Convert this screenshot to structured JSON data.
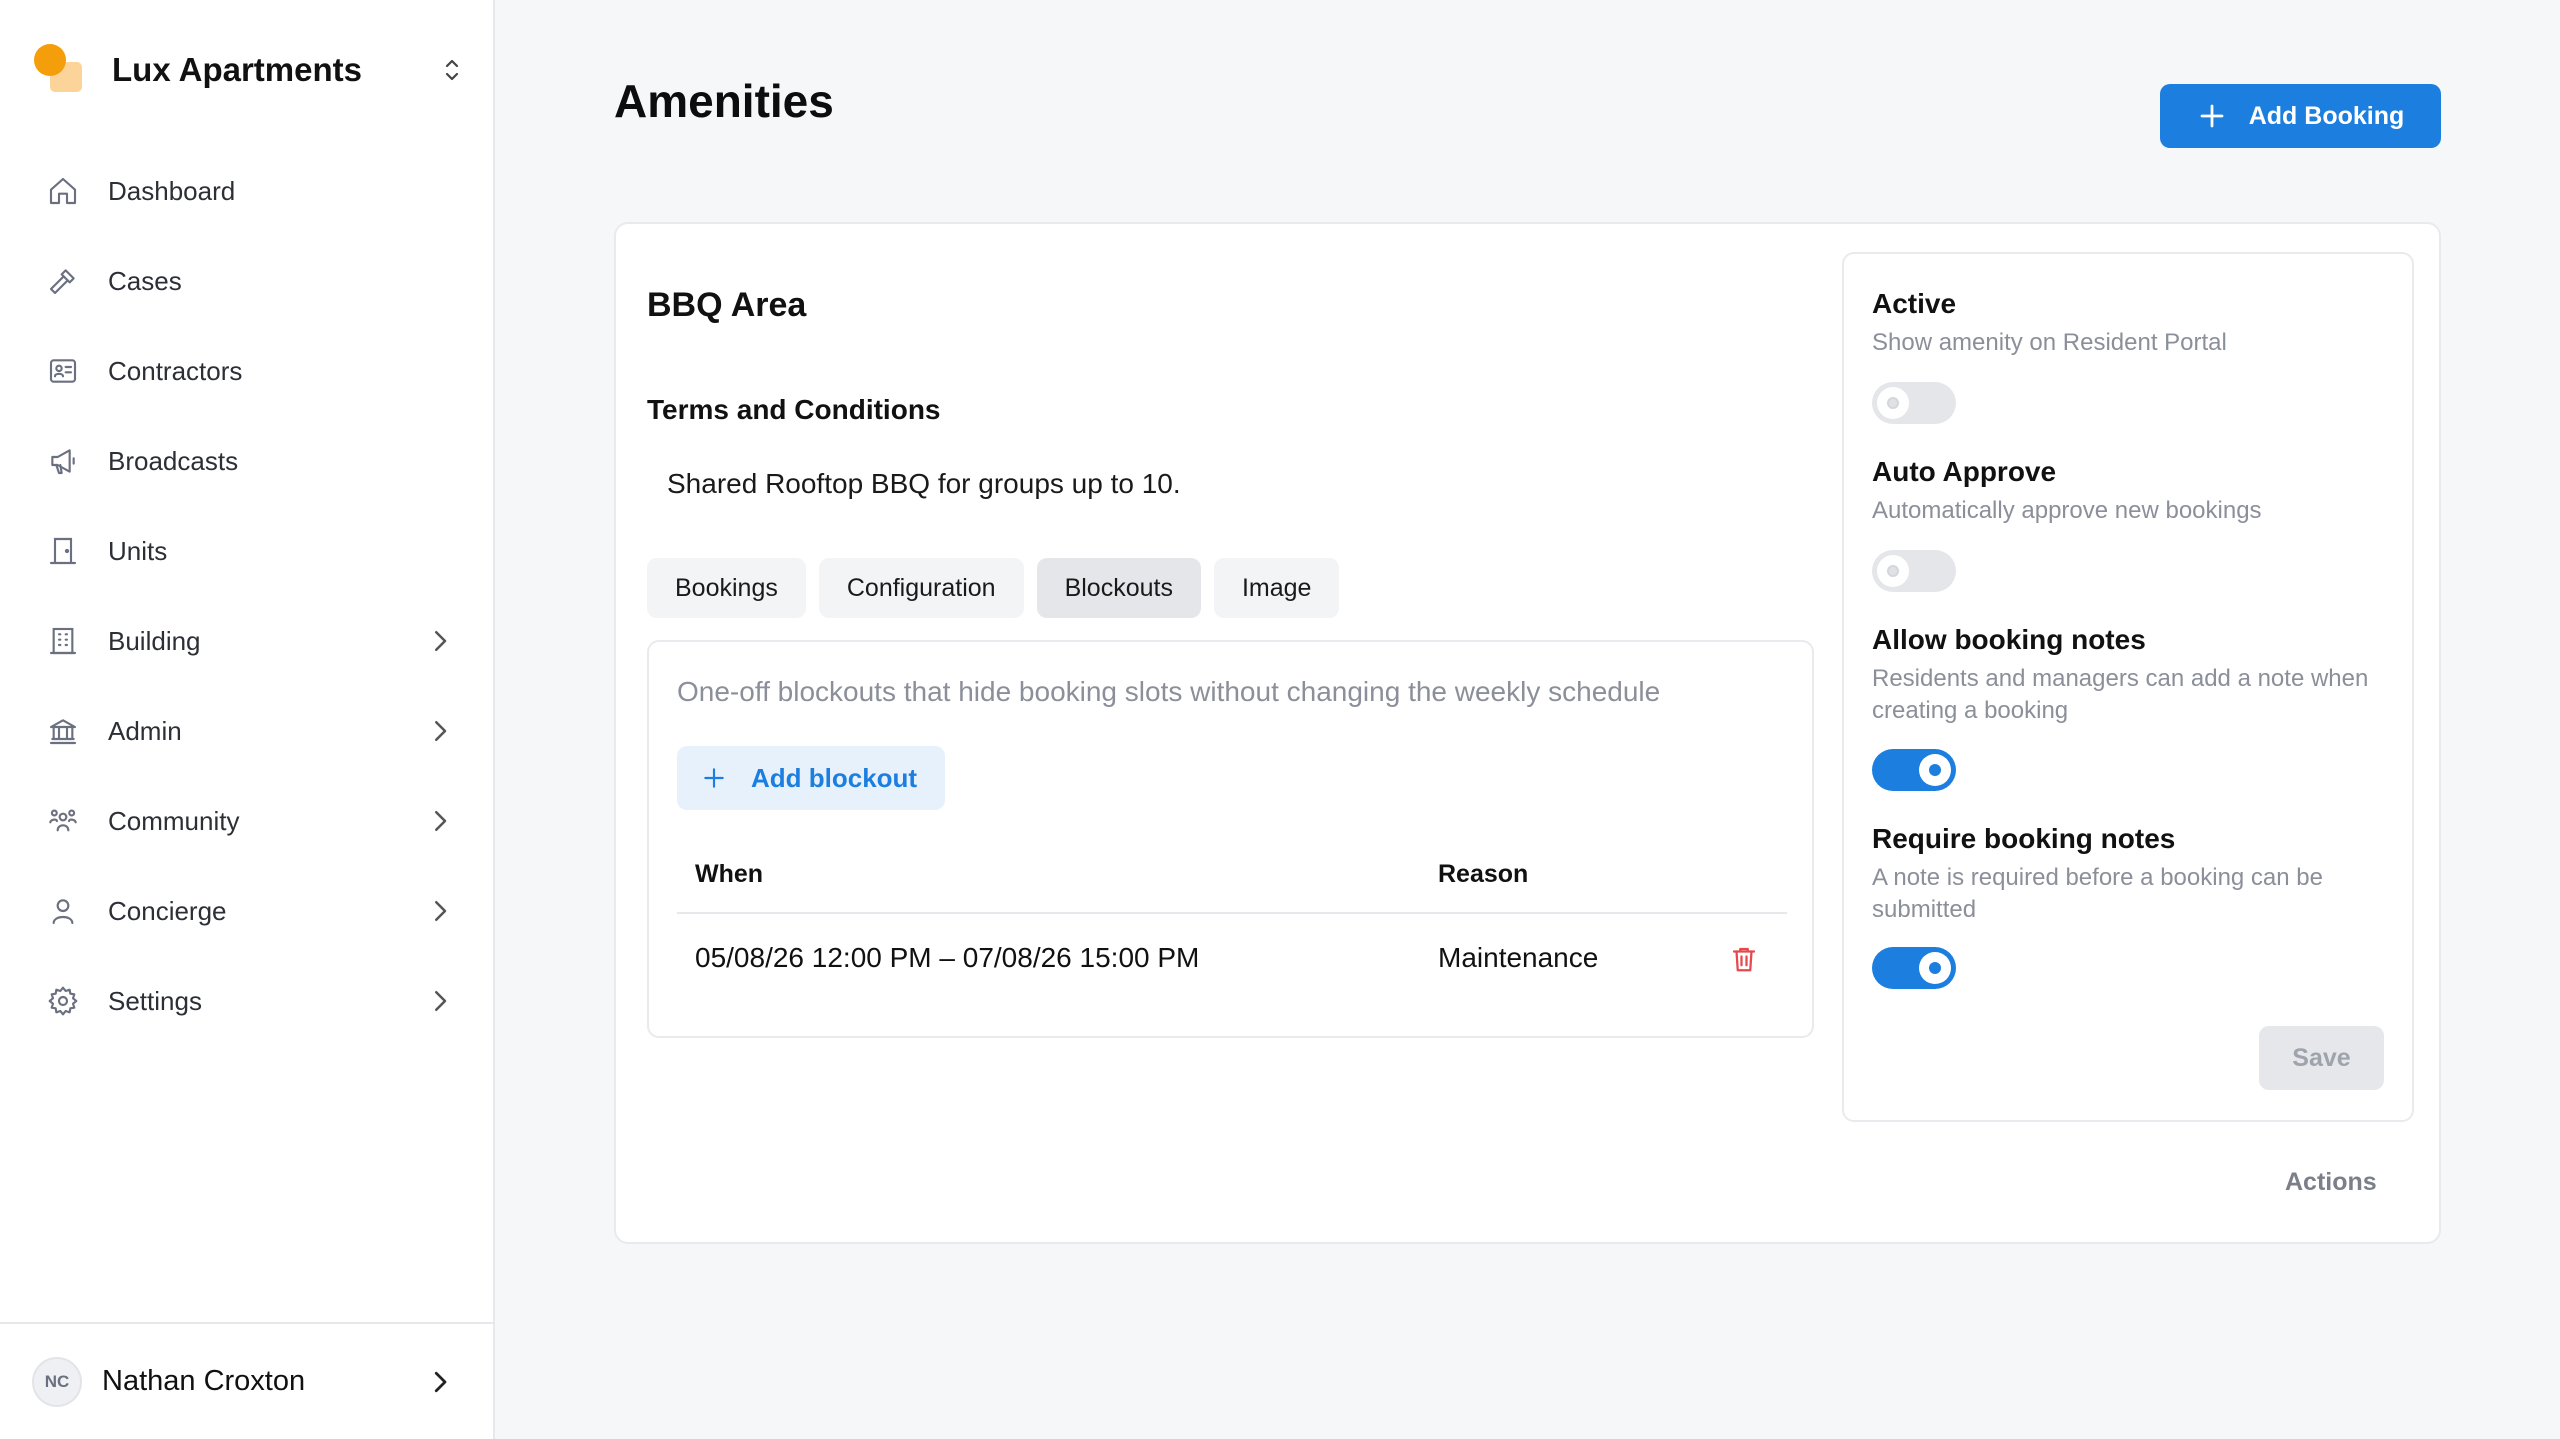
{
  "org": {
    "name": "Lux Apartments"
  },
  "nav": [
    {
      "label": "Dashboard",
      "icon": "home-icon",
      "has_children": false
    },
    {
      "label": "Cases",
      "icon": "hammer-icon",
      "has_children": false
    },
    {
      "label": "Contractors",
      "icon": "id-card-icon",
      "has_children": false
    },
    {
      "label": "Broadcasts",
      "icon": "megaphone-icon",
      "has_children": false
    },
    {
      "label": "Units",
      "icon": "door-icon",
      "has_children": false
    },
    {
      "label": "Building",
      "icon": "building-icon",
      "has_children": true
    },
    {
      "label": "Admin",
      "icon": "bank-icon",
      "has_children": true
    },
    {
      "label": "Community",
      "icon": "users-icon",
      "has_children": true
    },
    {
      "label": "Concierge",
      "icon": "person-icon",
      "has_children": true
    },
    {
      "label": "Settings",
      "icon": "gear-icon",
      "has_children": true
    }
  ],
  "user": {
    "initials": "NC",
    "name": "Nathan Croxton"
  },
  "page": {
    "title": "Amenities",
    "add_booking_label": "Add Booking"
  },
  "amenity": {
    "name": "BBQ Area",
    "terms_title": "Terms and Conditions",
    "terms_text": "Shared Rooftop BBQ for groups up to 10.",
    "tabs": [
      {
        "label": "Bookings",
        "active": false
      },
      {
        "label": "Configuration",
        "active": false
      },
      {
        "label": "Blockouts",
        "active": true
      },
      {
        "label": "Image",
        "active": false
      }
    ],
    "blockouts": {
      "description": "One-off blockouts that hide booking slots without changing the weekly schedule",
      "add_label": "Add blockout",
      "columns": {
        "when": "When",
        "reason": "Reason"
      },
      "rows": [
        {
          "when": "05/08/26 12:00 PM – 07/08/26 15:00 PM",
          "reason": "Maintenance"
        }
      ]
    }
  },
  "settings": [
    {
      "title": "Active",
      "description": "Show amenity on Resident Portal",
      "enabled": false
    },
    {
      "title": "Auto Approve",
      "description": "Automatically approve new bookings",
      "enabled": false
    },
    {
      "title": "Allow booking notes",
      "description": "Residents and managers can add a note when creating a booking",
      "enabled": true
    },
    {
      "title": "Require booking notes",
      "description": "A note is required before a booking can be submitted",
      "enabled": true
    }
  ],
  "save_label": "Save",
  "actions_label": "Actions",
  "colors": {
    "primary": "#1c7fdf",
    "danger": "#e5484d",
    "logo_orange": "#f59e0b",
    "logo_light": "#fcd49a"
  }
}
